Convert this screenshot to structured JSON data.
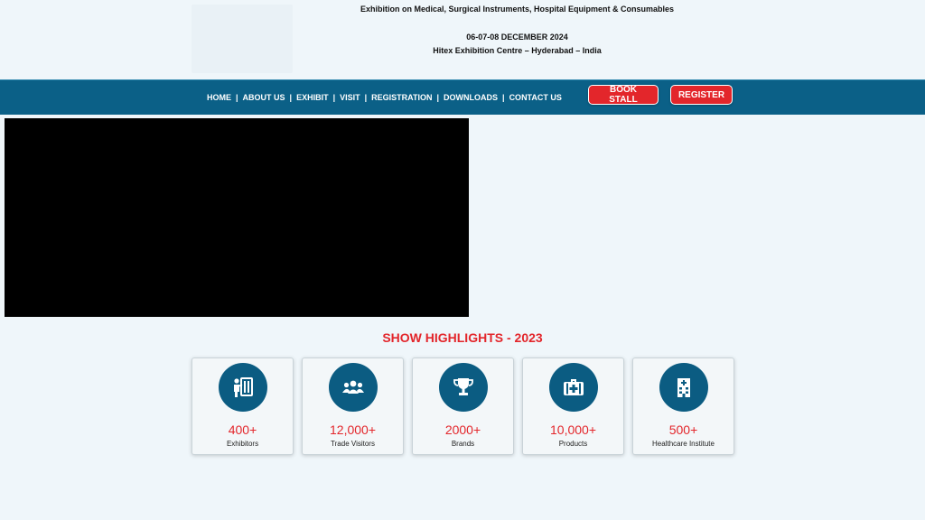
{
  "header": {
    "tagline": "Exhibition on Medical, Surgical Instruments, Hospital Equipment & Consumables",
    "dates": "06-07-08 DECEMBER 2024",
    "venue": "Hitex Exhibition Centre – Hyderabad – India"
  },
  "nav": {
    "items": [
      "HOME",
      "ABOUT US",
      "EXHIBIT",
      "VISIT",
      "REGISTRATION",
      "DOWNLOADS",
      "CONTACT US"
    ],
    "separator": "|",
    "book_stall": "BOOK STALL",
    "register": "REGISTER"
  },
  "highlights": {
    "title": "SHOW HIGHLIGHTS - 2023",
    "cards": [
      {
        "number": "400+",
        "label": "Exhibitors",
        "icon": "exhibitor-icon"
      },
      {
        "number": "12,000+",
        "label": "Trade Visitors",
        "icon": "visitors-group-icon"
      },
      {
        "number": "2000+",
        "label": "Brands",
        "icon": "trophy-icon"
      },
      {
        "number": "10,000+",
        "label": "Products",
        "icon": "medical-kit-icon"
      },
      {
        "number": "500+",
        "label": "Healthcare Institute",
        "icon": "hospital-building-icon"
      }
    ]
  },
  "colors": {
    "nav_bg": "#0b6087",
    "accent_red": "#e3262b",
    "icon_circle": "#0b5c82",
    "page_bg": "#eff6fa"
  }
}
